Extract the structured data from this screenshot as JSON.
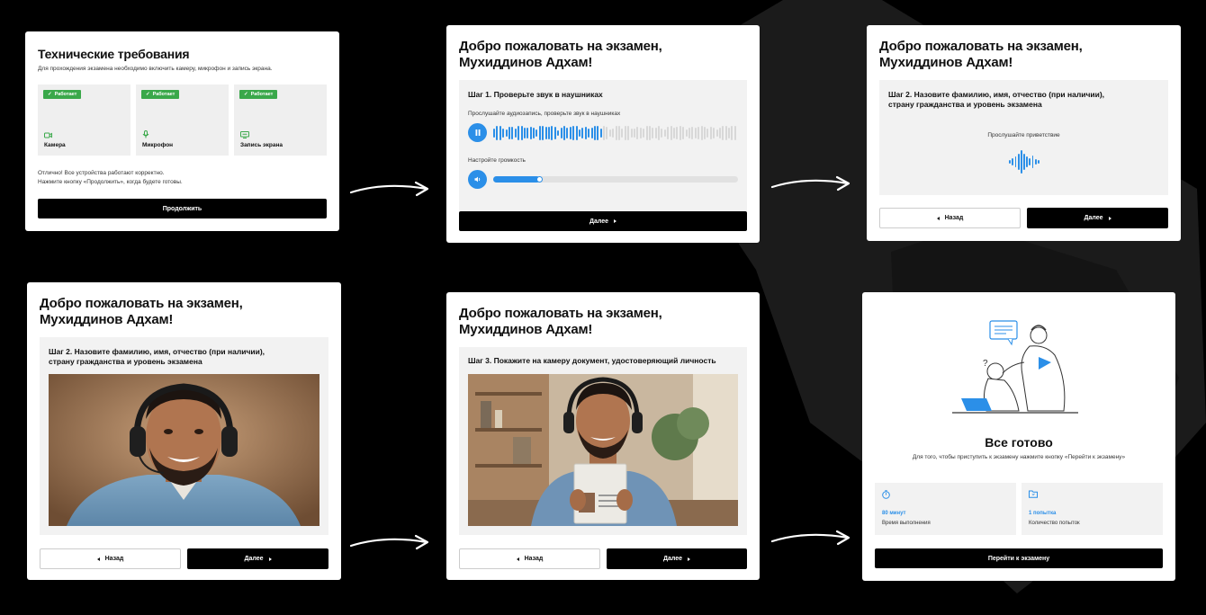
{
  "colors": {
    "accent": "#2b8fe8",
    "success": "#3aa84a",
    "background": "#000000"
  },
  "screen1": {
    "title": "Технические требования",
    "subtitle": "Для прохождения экзамена необходимо включить камеру, микрофон и запись экрана.",
    "devices": [
      {
        "badge": "Работает",
        "label": "Камера",
        "icon": "camera-icon"
      },
      {
        "badge": "Работает",
        "label": "Микрофон",
        "icon": "microphone-icon"
      },
      {
        "badge": "Работает",
        "label": "Запись экрана",
        "icon": "screen-record-icon"
      }
    ],
    "status_line1": "Отлично! Все устройства работают корректно.",
    "status_line2": "Нажмите кнопку «Продолжить», когда будете готовы.",
    "continue_label": "Продолжить"
  },
  "screen2": {
    "title": "Добро пожаловать на экзамен,\nМухиддинов Адхам!",
    "step": "Шаг 1. Проверьте звук в наушниках",
    "audio_hint": "Прослушайте аудиозапись, проверьте звук в наушниках",
    "volume_label": "Настройте громкость",
    "volume_level": 0.19,
    "playback_progress": 0.45,
    "next_label": "Далее"
  },
  "screen3": {
    "title": "Добро пожаловать на экзамен,\nМухиддинов Адхам!",
    "step": "Шаг 2. Назовите фамилию, имя, отчество (при наличии),\nстрану гражданства и уровень экзамена",
    "listen_label": "Прослушайте приветствие",
    "back_label": "Назад",
    "next_label": "Далее"
  },
  "screen4": {
    "title": "Добро пожаловать на экзамен,\nМухиддинов Адхам!",
    "step": "Шаг 2. Назовите фамилию, имя, отчество (при наличии),\nстрану гражданства и уровень экзамена",
    "back_label": "Назад",
    "next_label": "Далее"
  },
  "screen5": {
    "title": "Добро пожаловать на экзамен,\nМухиддинов Адхам!",
    "step": "Шаг 3. Покажите на камеру документ, удостоверяющий личность",
    "back_label": "Назад",
    "next_label": "Далее"
  },
  "screen6": {
    "title": "Все готово",
    "subtitle": "Для того, чтобы приступить к экзамену нажмите кнопку «Перейти к экзамену»",
    "duration_value": "80 минут",
    "duration_label": "Время выполнения",
    "attempts_value": "1 попытка",
    "attempts_label": "Количество попыток",
    "go_label": "Перейти к экзамену"
  }
}
